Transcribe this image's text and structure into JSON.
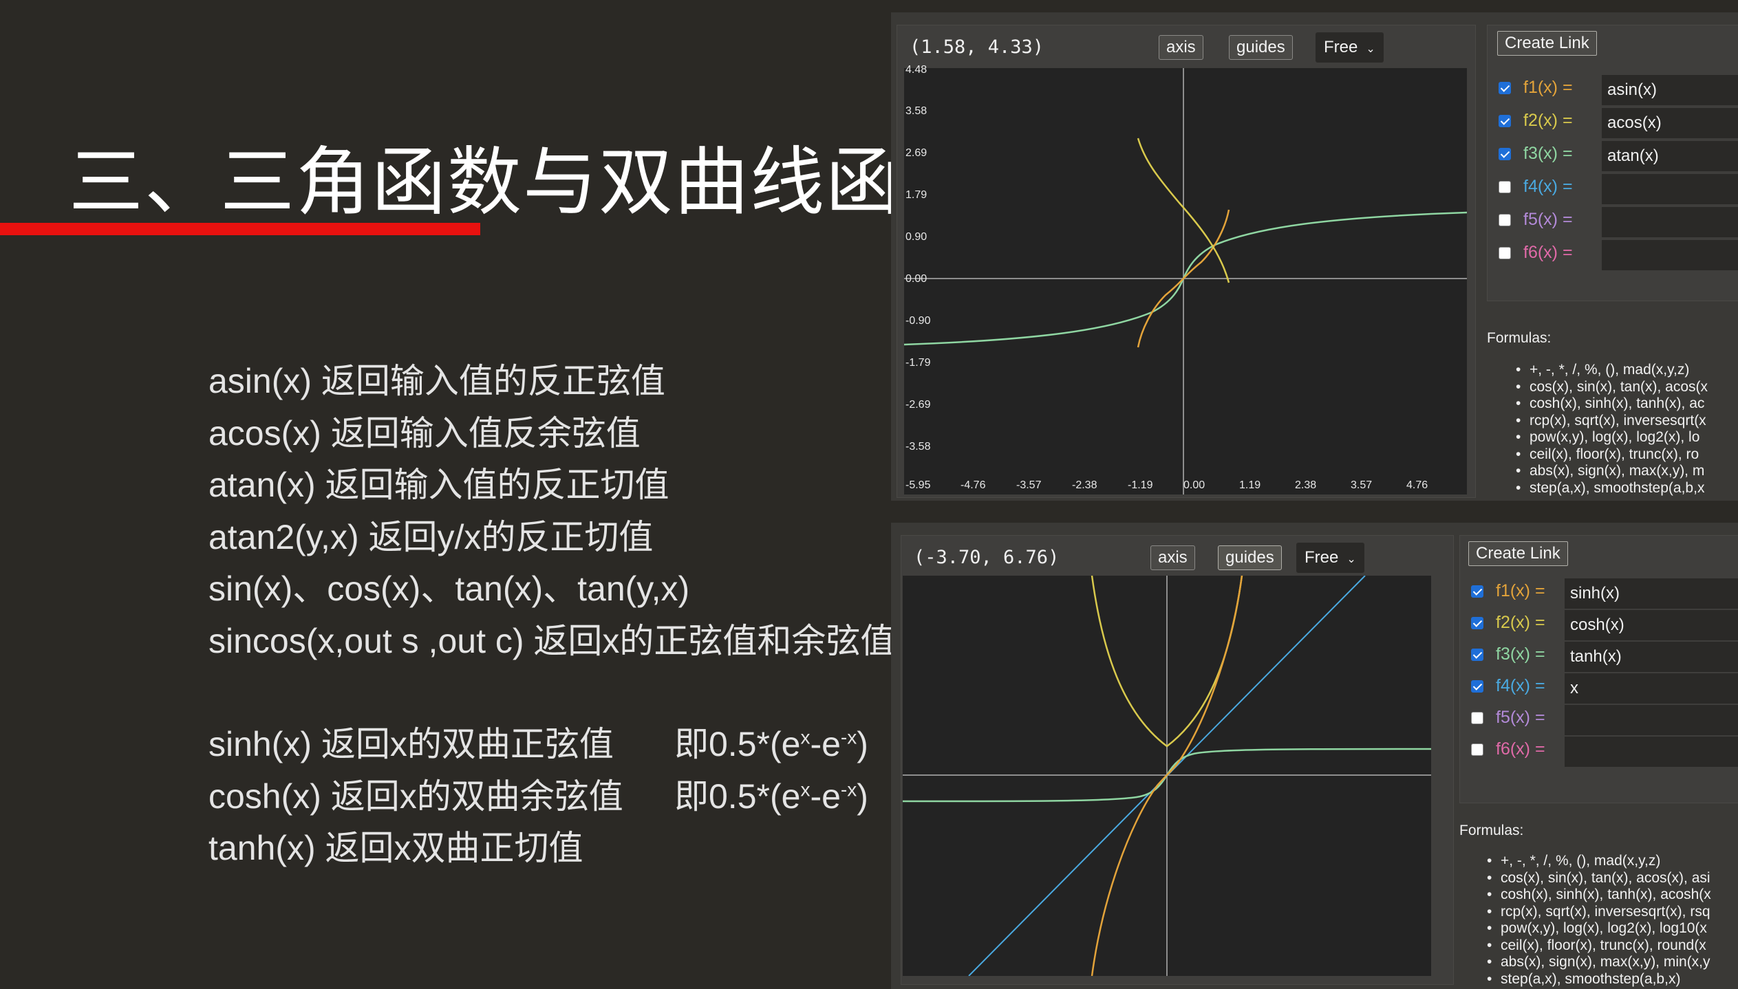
{
  "slide": {
    "title": "三、三角函数与双曲线函数",
    "colors": {
      "background": "#2b2925",
      "accent_bar": "#e8110f"
    },
    "bullets": [
      "asin(x) 返回输入值的反正弦值",
      "acos(x) 返回输入值反余弦值",
      "atan(x) 返回输入值的反正切值",
      "atan2(y,x) 返回y/x的反正切值",
      "sin(x)、cos(x)、tan(x)、tan(y,x)",
      "sincos(x,out s ,out c) 返回x的正弦值和余弦值",
      "sinh(x) 返回x的双曲正弦值",
      "cosh(x) 返回x的双曲余弦值",
      "tanh(x) 返回x双曲正切值"
    ],
    "formula_notes": [
      {
        "prefix": "即0.5*(e",
        "sup1": "x",
        "mid": "-e",
        "sup2": "-x",
        "suffix": ")"
      },
      {
        "prefix": "即0.5*(e",
        "sup1": "x",
        "mid": "-e",
        "sup2": "-x",
        "suffix": ")"
      }
    ]
  },
  "apps": [
    {
      "coords": "(1.58, 4.33)",
      "axis_label": "axis",
      "guides_label": "guides",
      "mode": "Free",
      "create_link": "Create Link",
      "y_ticks": [
        "4.48",
        "3.58",
        "2.69",
        "1.79",
        "0.90",
        "0.00",
        "-0.90",
        "-1.79",
        "-2.69",
        "-3.58"
      ],
      "x_ticks": [
        "-5.95",
        "-4.76",
        "-3.57",
        "-2.38",
        "-1.19",
        "0.00",
        "1.19",
        "2.38",
        "3.57",
        "4.76"
      ],
      "functions": [
        {
          "label": "f1(x) =",
          "value": "asin(x)",
          "checked": true,
          "color": "#e3a33a"
        },
        {
          "label": "f2(x) =",
          "value": "acos(x)",
          "checked": true,
          "color": "#d8c94c"
        },
        {
          "label": "f3(x) =",
          "value": "atan(x)",
          "checked": true,
          "color": "#8fd6a2"
        },
        {
          "label": "f4(x) =",
          "value": "",
          "checked": false,
          "color": "#4aa9e0"
        },
        {
          "label": "f5(x) =",
          "value": "",
          "checked": false,
          "color": "#b38ad8"
        },
        {
          "label": "f6(x) =",
          "value": "",
          "checked": false,
          "color": "#e06aa8"
        }
      ],
      "formulas_title": "Formulas:",
      "formulas": [
        "+, -, *, /, %, (), mad(x,y,z)",
        "cos(x), sin(x), tan(x), acos(x",
        "cosh(x), sinh(x), tanh(x), ac",
        "rcp(x), sqrt(x), inversesqrt(x",
        "pow(x,y), log(x), log2(x), lo",
        "ceil(x), floor(x), trunc(x), ro",
        "abs(x), sign(x), max(x,y), m",
        "step(a,x), smoothstep(a,b,x"
      ]
    },
    {
      "coords": "(-3.70, 6.76)",
      "axis_label": "axis",
      "guides_label": "guides",
      "mode": "Free",
      "create_link": "Create Link",
      "functions": [
        {
          "label": "f1(x) =",
          "value": "sinh(x)",
          "checked": true,
          "color": "#e3a33a"
        },
        {
          "label": "f2(x) =",
          "value": "cosh(x)",
          "checked": true,
          "color": "#d8c94c"
        },
        {
          "label": "f3(x) =",
          "value": "tanh(x)",
          "checked": true,
          "color": "#8fd6a2"
        },
        {
          "label": "f4(x) =",
          "value": "x",
          "checked": true,
          "color": "#4aa9e0"
        },
        {
          "label": "f5(x) =",
          "value": "",
          "checked": false,
          "color": "#b38ad8"
        },
        {
          "label": "f6(x) =",
          "value": "",
          "checked": false,
          "color": "#e06aa8"
        }
      ],
      "formulas_title": "Formulas:",
      "formulas": [
        "+, -, *, /, %, (), mad(x,y,z)",
        "cos(x), sin(x), tan(x), acos(x), asi",
        "cosh(x), sinh(x), tanh(x), acosh(x",
        "rcp(x), sqrt(x), inversesqrt(x), rsq",
        "pow(x,y), log(x), log2(x), log10(x",
        "ceil(x), floor(x), trunc(x), round(x",
        "abs(x), sign(x), max(x,y), min(x,y",
        "step(a,x), smoothstep(a,b,x)"
      ]
    }
  ]
}
